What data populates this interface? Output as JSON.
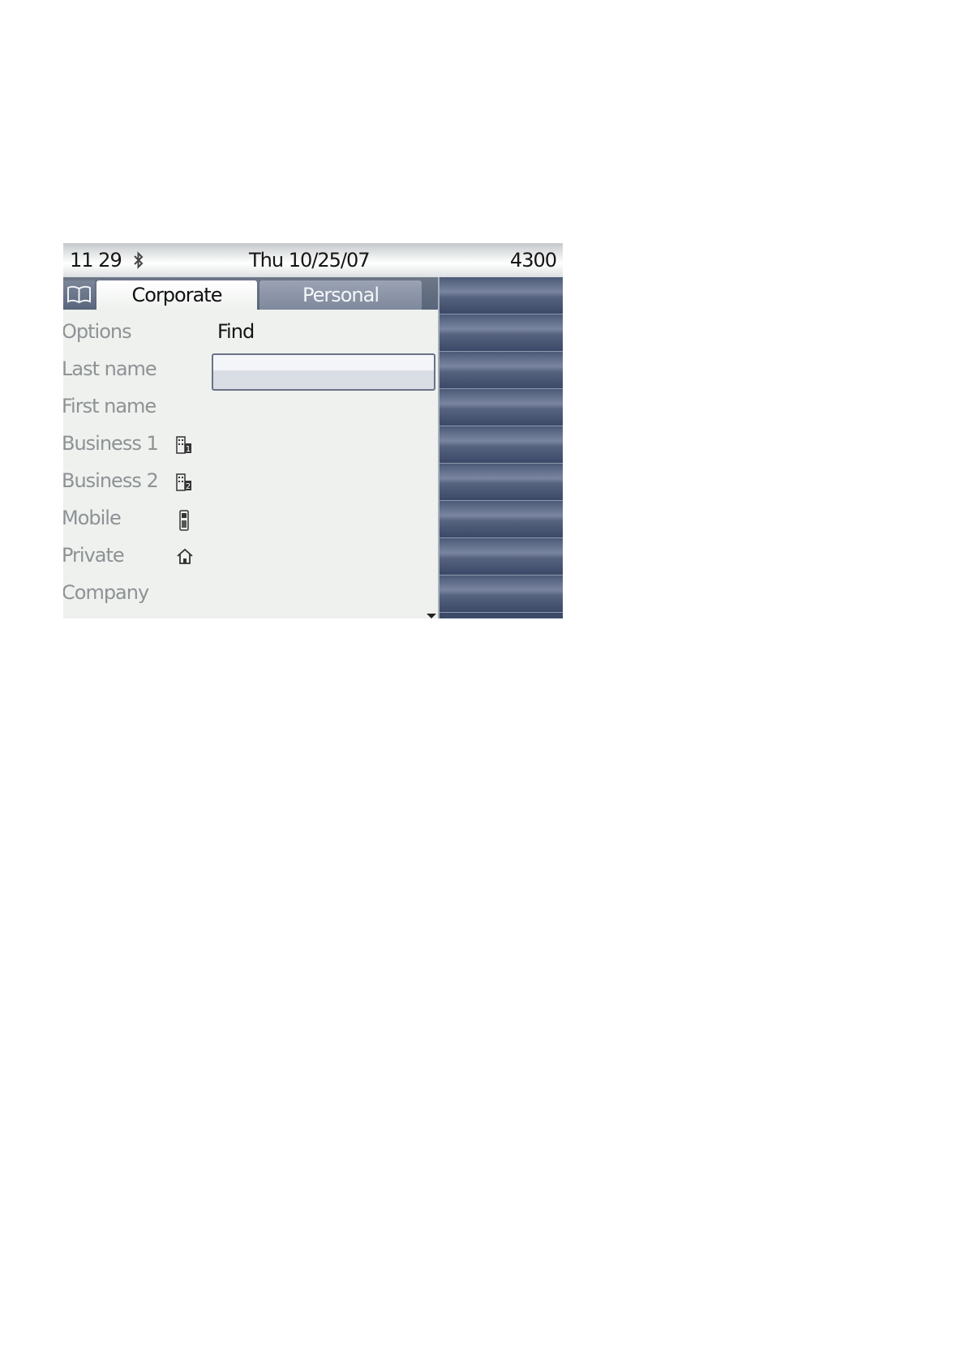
{
  "status_bar": {
    "time": "11 29",
    "date": "Thu 10/25/07",
    "extension": "4300",
    "bluetooth_icon": "bluetooth-icon"
  },
  "tabs": [
    {
      "label": "Corporate",
      "selected": true
    },
    {
      "label": "Personal",
      "selected": false
    }
  ],
  "phonebook_icon": "book-icon",
  "form": {
    "find_label": "Find",
    "last_name_value": "",
    "fields": [
      {
        "label": "Options",
        "icon": ""
      },
      {
        "label": "Last name",
        "icon": ""
      },
      {
        "label": "First name",
        "icon": ""
      },
      {
        "label": "Business 1",
        "icon": "business-1-icon"
      },
      {
        "label": "Business 2",
        "icon": "business-2-icon"
      },
      {
        "label": "Mobile",
        "icon": "mobile-phone-icon"
      },
      {
        "label": "Private",
        "icon": "home-icon"
      },
      {
        "label": "Company",
        "icon": ""
      }
    ]
  },
  "colors": {
    "panel_blue": "#3c4a68",
    "tab_active": "#ffffff",
    "tab_inactive": "#8a93a5",
    "label_gray": "#8e9295"
  }
}
